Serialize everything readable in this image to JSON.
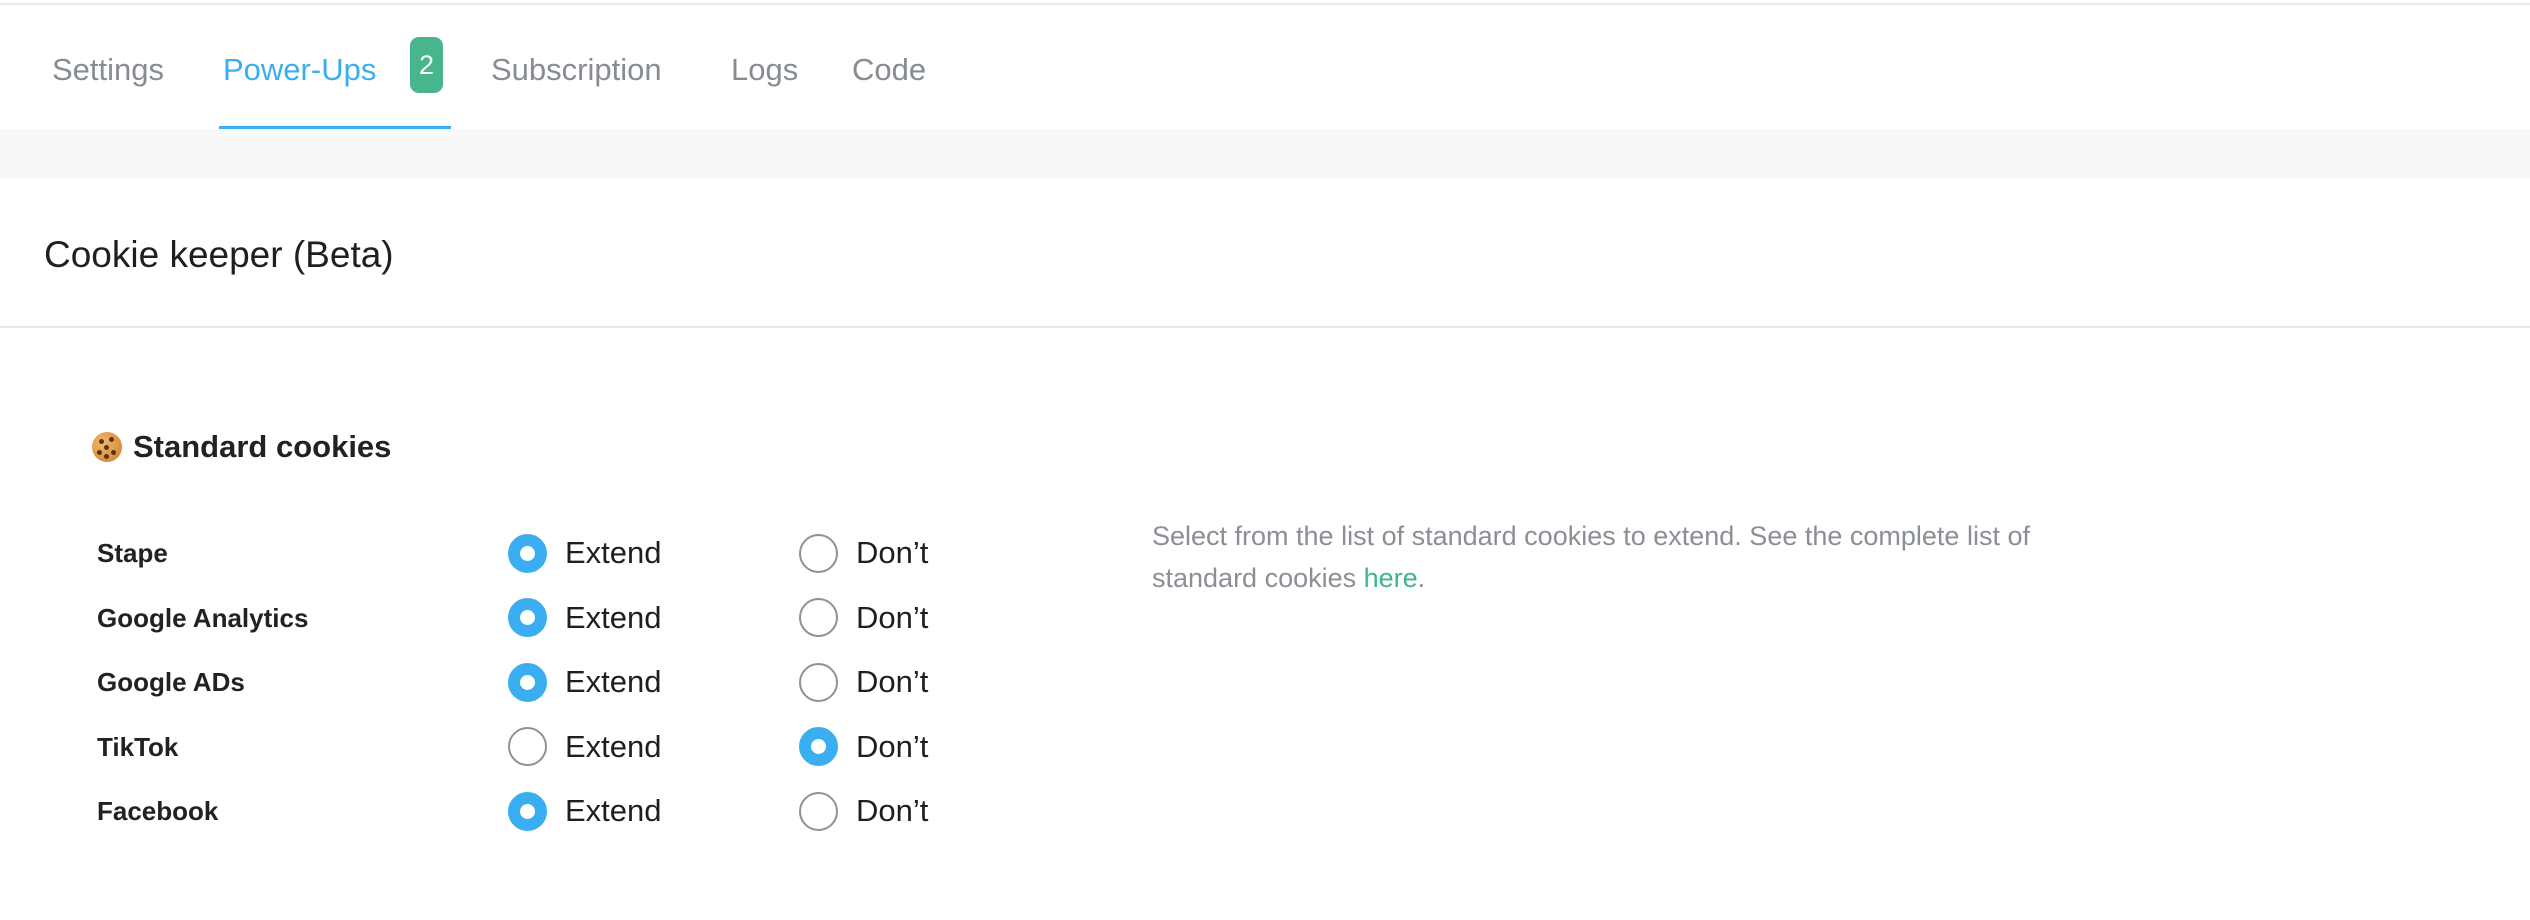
{
  "tabs": {
    "items": [
      {
        "label": "Settings",
        "active": false
      },
      {
        "label": "Power-Ups",
        "active": true,
        "badge": "2"
      },
      {
        "label": "Subscription",
        "active": false
      },
      {
        "label": "Logs",
        "active": false
      },
      {
        "label": "Code",
        "active": false
      }
    ]
  },
  "card": {
    "title": "Cookie keeper (Beta)"
  },
  "section": {
    "icon": "cookie-icon",
    "title": "Standard cookies"
  },
  "options": {
    "extend_label": "Extend",
    "dont_label": "Don’t"
  },
  "cookies": [
    {
      "name": "Stape",
      "selected": "extend"
    },
    {
      "name": "Google Analytics",
      "selected": "extend"
    },
    {
      "name": "Google ADs",
      "selected": "extend"
    },
    {
      "name": "TikTok",
      "selected": "dont"
    },
    {
      "name": "Facebook",
      "selected": "extend"
    }
  ],
  "help": {
    "text_before": "Select from the list of standard cookies to extend. See the complete list of standard cookies ",
    "link_text": "here",
    "text_after": "."
  },
  "colors": {
    "accent": "#3aaef0",
    "badge": "#48b58c",
    "link": "#3fb68b",
    "muted_text": "#878c92"
  }
}
